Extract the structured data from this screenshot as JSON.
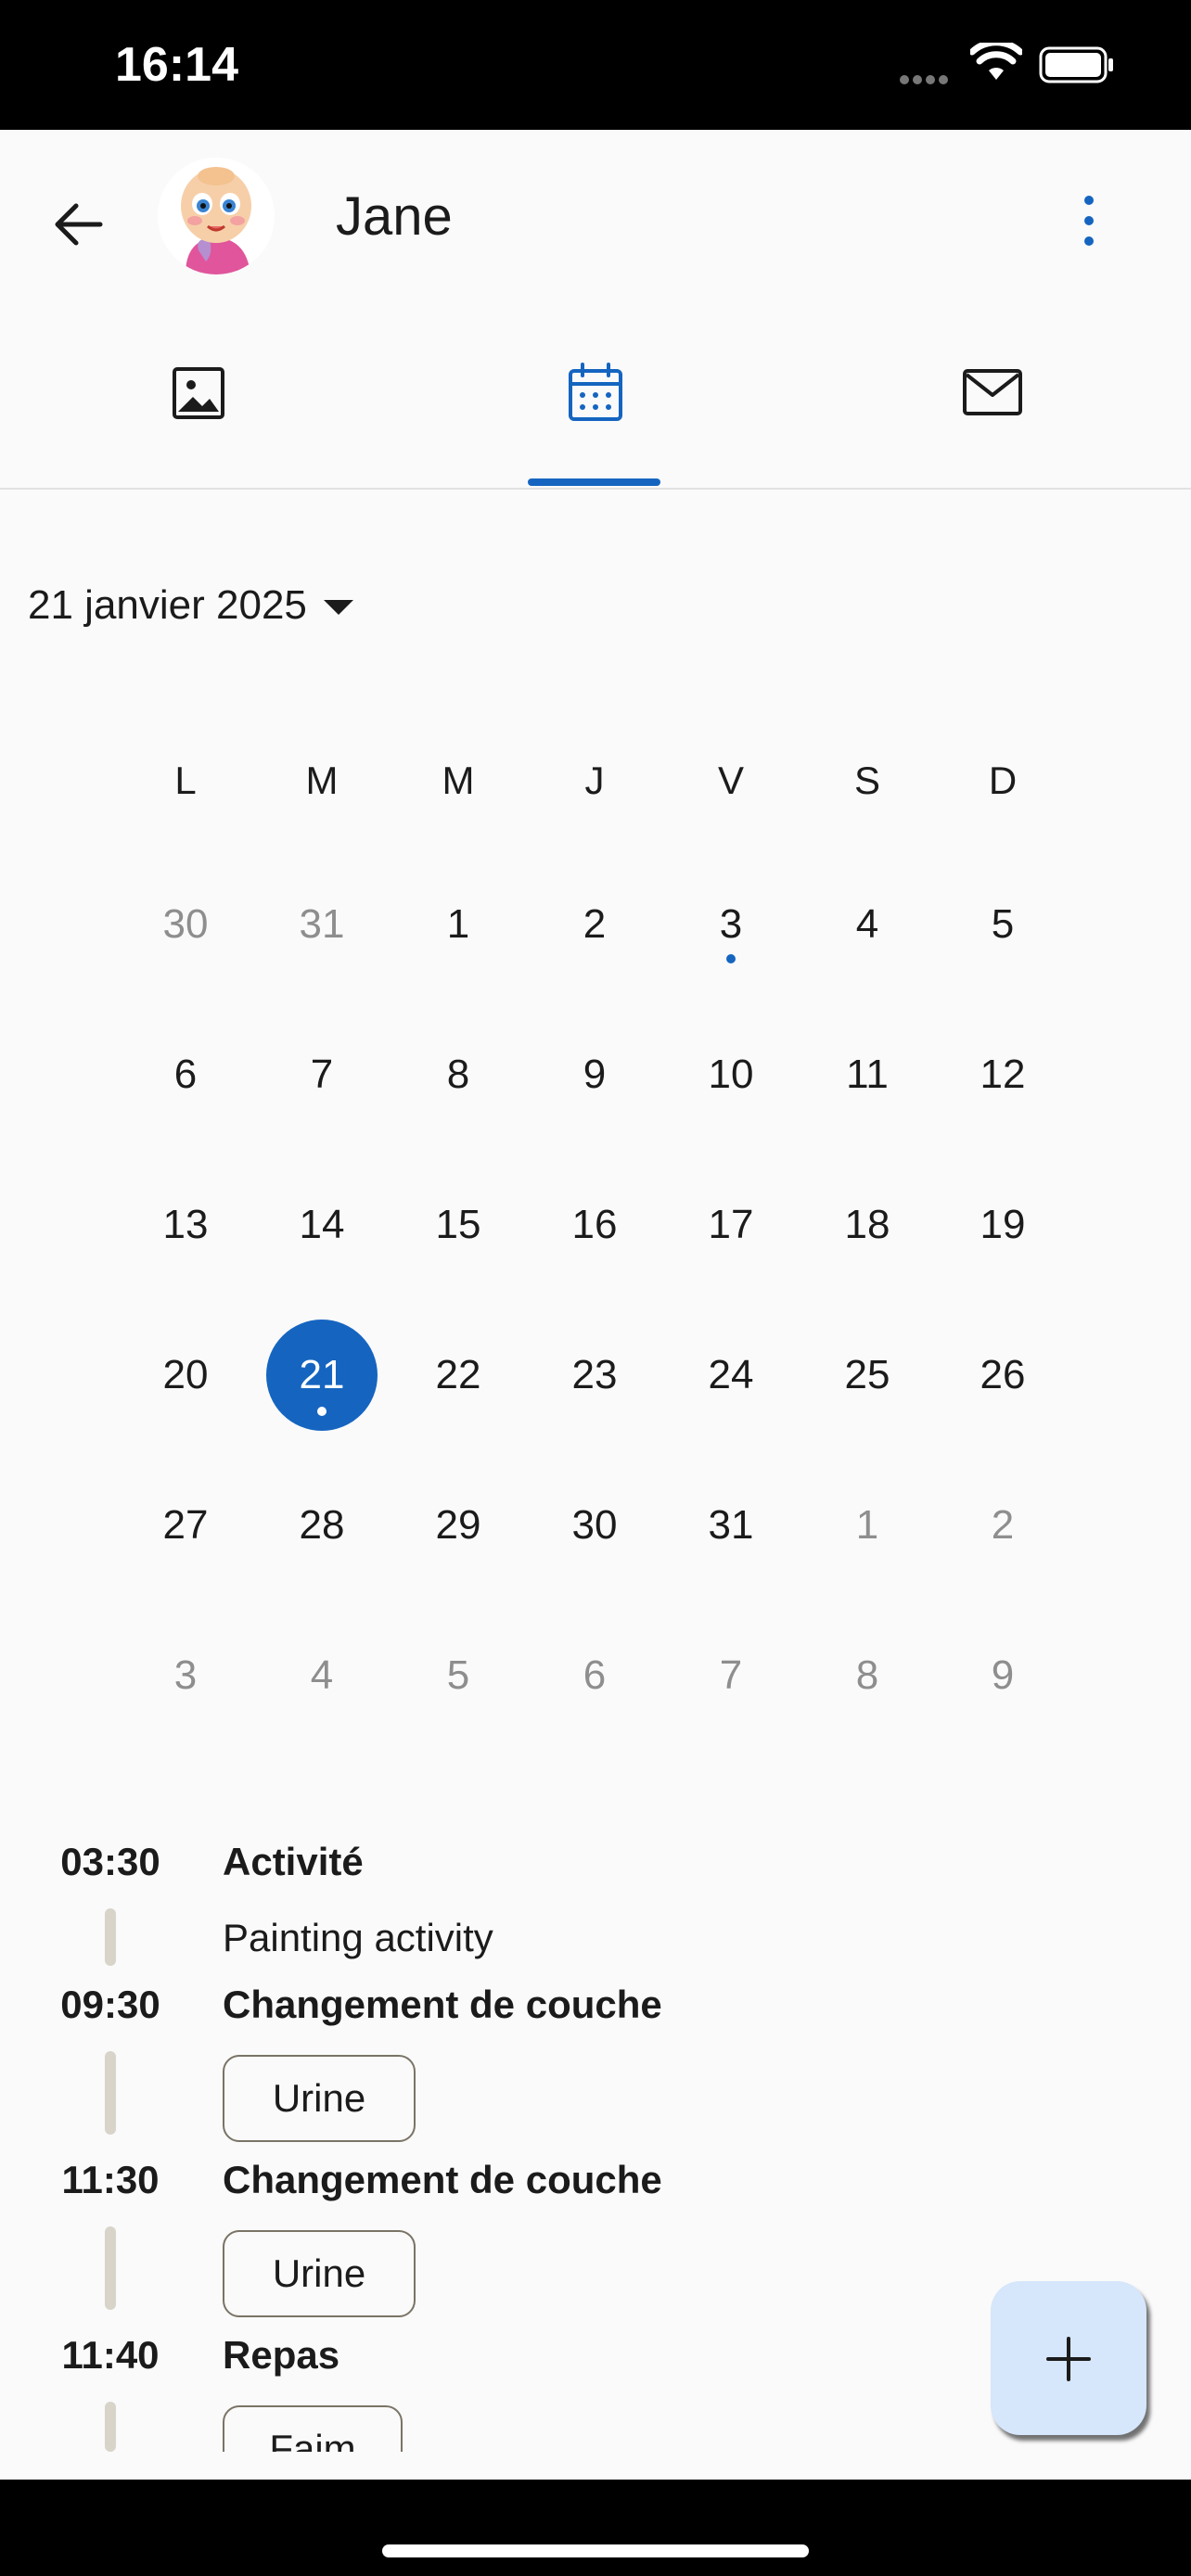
{
  "status_bar": {
    "time": "16:14"
  },
  "header": {
    "name": "Jane"
  },
  "tabs": [
    {
      "icon": "photo-icon"
    },
    {
      "icon": "calendar-icon",
      "selected": true
    },
    {
      "icon": "mail-icon"
    }
  ],
  "calendar": {
    "month_label": "21 janvier 2025",
    "weekdays": [
      "L",
      "M",
      "M",
      "J",
      "V",
      "S",
      "D"
    ],
    "weeks": [
      [
        "30",
        "31",
        "1",
        "2",
        "3",
        "4",
        "5"
      ],
      [
        "6",
        "7",
        "8",
        "9",
        "10",
        "11",
        "12"
      ],
      [
        "13",
        "14",
        "15",
        "16",
        "17",
        "18",
        "19"
      ],
      [
        "20",
        "21",
        "22",
        "23",
        "24",
        "25",
        "26"
      ],
      [
        "27",
        "28",
        "29",
        "30",
        "31",
        "1",
        "2"
      ],
      [
        "3",
        "4",
        "5",
        "6",
        "7",
        "8",
        "9"
      ]
    ],
    "selected_day": "21",
    "days_with_events": [
      "3",
      "21"
    ]
  },
  "timeline": [
    {
      "time": "03:30",
      "title": "Activité",
      "note": "Painting activity"
    },
    {
      "time": "09:30",
      "title": "Changement de couche",
      "chip": "Urine"
    },
    {
      "time": "11:30",
      "title": "Changement de couche",
      "chip": "Urine"
    },
    {
      "time": "11:40",
      "title": "Repas",
      "chip": "Faim"
    }
  ],
  "colors": {
    "accent": "#1565c0",
    "fab_bg": "#d6e6fb"
  }
}
